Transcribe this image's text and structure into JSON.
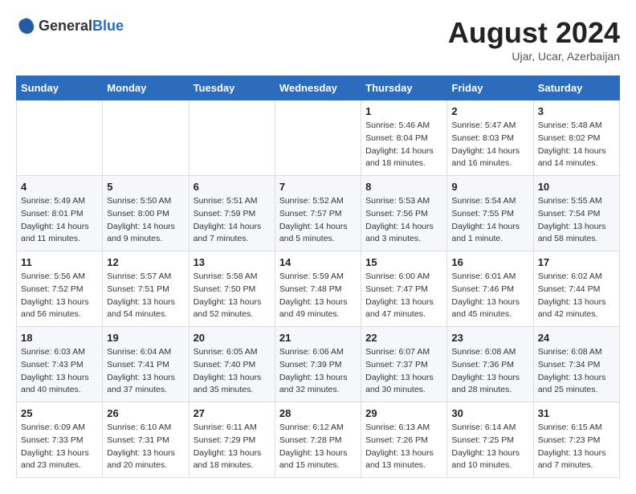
{
  "logo": {
    "general": "General",
    "blue": "Blue"
  },
  "title": {
    "month_year": "August 2024",
    "location": "Ujar, Ucar, Azerbaijan"
  },
  "days_of_week": [
    "Sunday",
    "Monday",
    "Tuesday",
    "Wednesday",
    "Thursday",
    "Friday",
    "Saturday"
  ],
  "weeks": [
    [
      {
        "day": "",
        "info": ""
      },
      {
        "day": "",
        "info": ""
      },
      {
        "day": "",
        "info": ""
      },
      {
        "day": "",
        "info": ""
      },
      {
        "day": "1",
        "info": "Sunrise: 5:46 AM\nSunset: 8:04 PM\nDaylight: 14 hours\nand 18 minutes."
      },
      {
        "day": "2",
        "info": "Sunrise: 5:47 AM\nSunset: 8:03 PM\nDaylight: 14 hours\nand 16 minutes."
      },
      {
        "day": "3",
        "info": "Sunrise: 5:48 AM\nSunset: 8:02 PM\nDaylight: 14 hours\nand 14 minutes."
      }
    ],
    [
      {
        "day": "4",
        "info": "Sunrise: 5:49 AM\nSunset: 8:01 PM\nDaylight: 14 hours\nand 11 minutes."
      },
      {
        "day": "5",
        "info": "Sunrise: 5:50 AM\nSunset: 8:00 PM\nDaylight: 14 hours\nand 9 minutes."
      },
      {
        "day": "6",
        "info": "Sunrise: 5:51 AM\nSunset: 7:59 PM\nDaylight: 14 hours\nand 7 minutes."
      },
      {
        "day": "7",
        "info": "Sunrise: 5:52 AM\nSunset: 7:57 PM\nDaylight: 14 hours\nand 5 minutes."
      },
      {
        "day": "8",
        "info": "Sunrise: 5:53 AM\nSunset: 7:56 PM\nDaylight: 14 hours\nand 3 minutes."
      },
      {
        "day": "9",
        "info": "Sunrise: 5:54 AM\nSunset: 7:55 PM\nDaylight: 14 hours\nand 1 minute."
      },
      {
        "day": "10",
        "info": "Sunrise: 5:55 AM\nSunset: 7:54 PM\nDaylight: 13 hours\nand 58 minutes."
      }
    ],
    [
      {
        "day": "11",
        "info": "Sunrise: 5:56 AM\nSunset: 7:52 PM\nDaylight: 13 hours\nand 56 minutes."
      },
      {
        "day": "12",
        "info": "Sunrise: 5:57 AM\nSunset: 7:51 PM\nDaylight: 13 hours\nand 54 minutes."
      },
      {
        "day": "13",
        "info": "Sunrise: 5:58 AM\nSunset: 7:50 PM\nDaylight: 13 hours\nand 52 minutes."
      },
      {
        "day": "14",
        "info": "Sunrise: 5:59 AM\nSunset: 7:48 PM\nDaylight: 13 hours\nand 49 minutes."
      },
      {
        "day": "15",
        "info": "Sunrise: 6:00 AM\nSunset: 7:47 PM\nDaylight: 13 hours\nand 47 minutes."
      },
      {
        "day": "16",
        "info": "Sunrise: 6:01 AM\nSunset: 7:46 PM\nDaylight: 13 hours\nand 45 minutes."
      },
      {
        "day": "17",
        "info": "Sunrise: 6:02 AM\nSunset: 7:44 PM\nDaylight: 13 hours\nand 42 minutes."
      }
    ],
    [
      {
        "day": "18",
        "info": "Sunrise: 6:03 AM\nSunset: 7:43 PM\nDaylight: 13 hours\nand 40 minutes."
      },
      {
        "day": "19",
        "info": "Sunrise: 6:04 AM\nSunset: 7:41 PM\nDaylight: 13 hours\nand 37 minutes."
      },
      {
        "day": "20",
        "info": "Sunrise: 6:05 AM\nSunset: 7:40 PM\nDaylight: 13 hours\nand 35 minutes."
      },
      {
        "day": "21",
        "info": "Sunrise: 6:06 AM\nSunset: 7:39 PM\nDaylight: 13 hours\nand 32 minutes."
      },
      {
        "day": "22",
        "info": "Sunrise: 6:07 AM\nSunset: 7:37 PM\nDaylight: 13 hours\nand 30 minutes."
      },
      {
        "day": "23",
        "info": "Sunrise: 6:08 AM\nSunset: 7:36 PM\nDaylight: 13 hours\nand 28 minutes."
      },
      {
        "day": "24",
        "info": "Sunrise: 6:08 AM\nSunset: 7:34 PM\nDaylight: 13 hours\nand 25 minutes."
      }
    ],
    [
      {
        "day": "25",
        "info": "Sunrise: 6:09 AM\nSunset: 7:33 PM\nDaylight: 13 hours\nand 23 minutes."
      },
      {
        "day": "26",
        "info": "Sunrise: 6:10 AM\nSunset: 7:31 PM\nDaylight: 13 hours\nand 20 minutes."
      },
      {
        "day": "27",
        "info": "Sunrise: 6:11 AM\nSunset: 7:29 PM\nDaylight: 13 hours\nand 18 minutes."
      },
      {
        "day": "28",
        "info": "Sunrise: 6:12 AM\nSunset: 7:28 PM\nDaylight: 13 hours\nand 15 minutes."
      },
      {
        "day": "29",
        "info": "Sunrise: 6:13 AM\nSunset: 7:26 PM\nDaylight: 13 hours\nand 13 minutes."
      },
      {
        "day": "30",
        "info": "Sunrise: 6:14 AM\nSunset: 7:25 PM\nDaylight: 13 hours\nand 10 minutes."
      },
      {
        "day": "31",
        "info": "Sunrise: 6:15 AM\nSunset: 7:23 PM\nDaylight: 13 hours\nand 7 minutes."
      }
    ]
  ]
}
